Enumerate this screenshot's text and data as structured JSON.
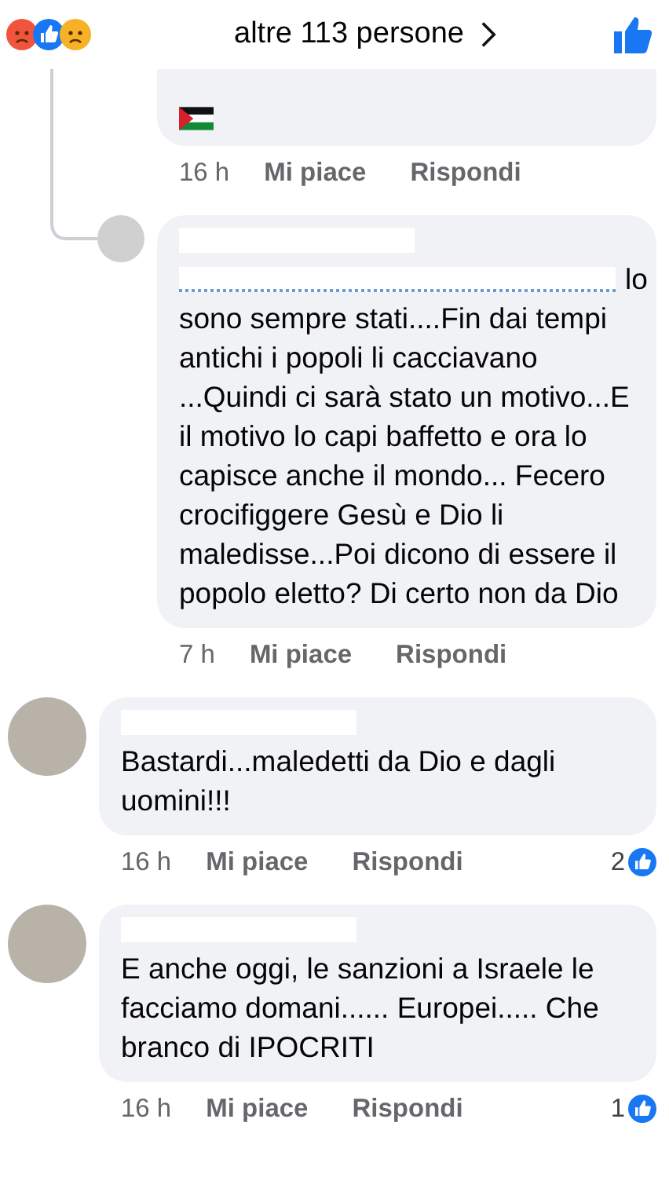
{
  "reactions_bar": {
    "summary": "altre 113 persone"
  },
  "comments": [
    {
      "kind": "flag",
      "nested": true,
      "time": "16 h",
      "like": "Mi piace",
      "reply": "Rispondi"
    },
    {
      "kind": "mention",
      "nested": true,
      "mention_tail": "lo",
      "body": "sono sempre stati....Fin dai tempi antichi i popoli li cacciavano ...Quindi ci sarà stato un motivo...E il motivo lo capi baffetto e ora lo capisce anche  il mondo... Fecero crocifiggere Gesù e Dio li maledisse...Poi dicono di essere il popolo eletto? Di certo non da Dio",
      "time": "7 h",
      "like": "Mi piace",
      "reply": "Rispondi"
    },
    {
      "kind": "text",
      "nested": false,
      "body": "Bastardi...maledetti da Dio e dagli uomini!!!",
      "time": "16 h",
      "like": "Mi piace",
      "reply": "Rispondi",
      "like_count": "2"
    },
    {
      "kind": "text",
      "nested": false,
      "body": "E anche oggi, le sanzioni a Israele le facciamo domani...... Europei..... Che branco di IPOCRITI",
      "time": "16 h",
      "like": "Mi piace",
      "reply": "Rispondi",
      "like_count": "1"
    }
  ]
}
